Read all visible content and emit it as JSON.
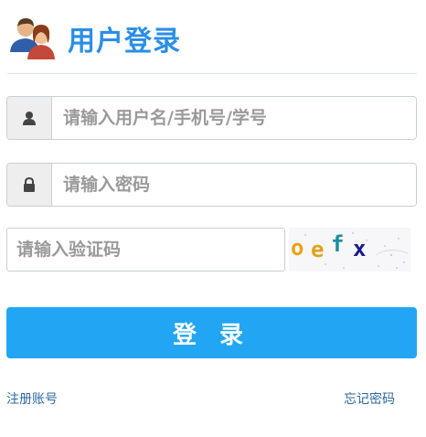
{
  "header": {
    "title": "用户登录",
    "icon": "users-icon"
  },
  "form": {
    "username": {
      "placeholder": "请输入用户名/手机号/学号",
      "icon": "user-icon"
    },
    "password": {
      "placeholder": "请输入密码",
      "icon": "lock-icon"
    },
    "captcha": {
      "placeholder": "请输入验证码",
      "code": [
        "o",
        "e",
        "f",
        "x"
      ]
    },
    "submit_label": "登 录"
  },
  "links": {
    "register": "注册账号",
    "forgot": "忘记密码"
  },
  "colors": {
    "accent": "#2b8ee6",
    "button": "#22a6f3",
    "link": "#2c6aa0"
  }
}
